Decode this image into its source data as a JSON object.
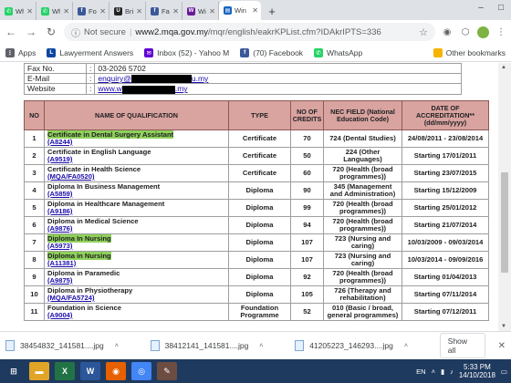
{
  "tabs": [
    {
      "title": "Wh",
      "icon": "whatsapp-icon",
      "color": "#25d366",
      "glyph": "✆"
    },
    {
      "title": "Wh",
      "icon": "whatsapp-icon",
      "color": "#25d366",
      "glyph": "✆"
    },
    {
      "title": "Fore",
      "icon": "facebook-icon",
      "color": "#3b5998",
      "glyph": "f"
    },
    {
      "title": "Britis",
      "icon": "ubuntu-u-icon",
      "color": "#222222",
      "glyph": "U"
    },
    {
      "title": "Face",
      "icon": "facebook-icon",
      "color": "#3b5998",
      "glyph": "f"
    },
    {
      "title": "Win",
      "icon": "win-icon",
      "color": "#6a1b9a",
      "glyph": "W"
    },
    {
      "title": "Win",
      "icon": "page-icon",
      "color": "#1565c0",
      "glyph": "▤",
      "active": true
    }
  ],
  "address": {
    "security": "Not secure",
    "host": "www2.mqa.gov.my",
    "path": "/mqr/english/eakrKPList.cfm?IDAkrIPTS=336"
  },
  "bookmarks": [
    {
      "label": "Apps",
      "icon": "apps-icon",
      "color": "#5f6368",
      "glyph": "⋮"
    },
    {
      "label": "Lawyerment Answers",
      "icon": "lawyerment-icon",
      "color": "#0d47a1",
      "glyph": "L"
    },
    {
      "label": "Inbox (52) - Yahoo M",
      "icon": "yahoo-mail-icon",
      "color": "#6001d2",
      "glyph": "✉"
    },
    {
      "label": "(70) Facebook",
      "icon": "facebook-icon",
      "color": "#3b5998",
      "glyph": "f"
    },
    {
      "label": "WhatsApp",
      "icon": "whatsapp-icon",
      "color": "#25d366",
      "glyph": "✆"
    }
  ],
  "other_bookmarks": "Other bookmarks",
  "contact": {
    "fax_label": "Fax No.",
    "fax": "03-2026 5702",
    "email_label": "E-Mail",
    "email_prefix": "enquiry@",
    "email_suffix": "u.my",
    "website_label": "Website",
    "website_prefix": "www.w",
    "website_suffix": ".my",
    "colon": ":"
  },
  "qualifications": {
    "headers": [
      "NO",
      "NAME OF QUALIFICATION",
      "TYPE",
      "NO OF CREDITS",
      "NEC FIELD (National Education Code)",
      "DATE OF ACCREDITATION** (dd/mm/yyyy)"
    ],
    "rows": [
      {
        "no": "1",
        "name": "Certificate in Dental Surgery Assistant",
        "code": "(A8244)",
        "type": "Certificate",
        "credits": "70",
        "nec": "724 (Dental Studies)",
        "date": "24/08/2011 - 23/08/2014",
        "highlight": true
      },
      {
        "no": "2",
        "name": "Certificate in English Language",
        "code": "(A9519)",
        "type": "Certificate",
        "credits": "50",
        "nec": "224 (Other Languages)",
        "date": "Starting 17/01/2011",
        "highlight": false
      },
      {
        "no": "3",
        "name": "Certificate in Health Science",
        "code": "(MQA/FA0520)",
        "type": "Certificate",
        "credits": "60",
        "nec": "720 (Health (broad programmes))",
        "date": "Starting 23/07/2015",
        "highlight": false
      },
      {
        "no": "4",
        "name": "Diploma In Business Management",
        "code": "(A5859)",
        "type": "Diploma",
        "credits": "90",
        "nec": "345 (Management and Administration)",
        "date": "Starting 15/12/2009",
        "highlight": false
      },
      {
        "no": "5",
        "name": "Diploma in Healthcare Management",
        "code": "(A9186)",
        "type": "Diploma",
        "credits": "99",
        "nec": "720 (Health (broad programmes))",
        "date": "Starting 25/01/2012",
        "highlight": false
      },
      {
        "no": "6",
        "name": "Diploma in Medical Science",
        "code": "(A9876)",
        "type": "Diploma",
        "credits": "94",
        "nec": "720 (Health (broad programmes))",
        "date": "Starting 21/07/2014",
        "highlight": false
      },
      {
        "no": "7",
        "name": "Diploma In Nursing",
        "code": "(A5973)",
        "type": "Diploma",
        "credits": "107",
        "nec": "723 (Nursing and caring)",
        "date": "10/03/2009 - 09/03/2014",
        "highlight": true
      },
      {
        "no": "8",
        "name": "Diploma in Nursing",
        "code": "(A11381)",
        "type": "Diploma",
        "credits": "107",
        "nec": "723 (Nursing and caring)",
        "date": "10/03/2014 - 09/09/2016",
        "highlight": true
      },
      {
        "no": "9",
        "name": "Diploma in Paramedic",
        "code": "(A9875)",
        "type": "Diploma",
        "credits": "92",
        "nec": "720 (Health (broad programmes))",
        "date": "Starting 01/04/2013",
        "highlight": false
      },
      {
        "no": "10",
        "name": "Diploma in Physiotherapy",
        "code": "(MQA/FA5724)",
        "type": "Diploma",
        "credits": "105",
        "nec": "726 (Therapy and rehabilitation)",
        "date": "Starting 07/11/2014",
        "highlight": false
      },
      {
        "no": "11",
        "name": "Foundation in Science",
        "code": "(A9004)",
        "type": "Foundation Programme",
        "credits": "52",
        "nec": "010 (Basic / broad, general programmes)",
        "date": "Starting 07/12/2011",
        "highlight": false
      }
    ]
  },
  "downloads": [
    {
      "name": "38454832_141581....jpg"
    },
    {
      "name": "38412141_141581....jpg"
    },
    {
      "name": "41205223_146293....jpg"
    }
  ],
  "show_all": "Show all",
  "taskbar": [
    {
      "icon": "start-icon",
      "color": "#1f3a5f",
      "glyph": "⊞"
    },
    {
      "icon": "file-explorer-icon",
      "color": "#e0a526",
      "glyph": "▬"
    },
    {
      "icon": "excel-icon",
      "color": "#217346",
      "glyph": "X"
    },
    {
      "icon": "word-icon",
      "color": "#2b579a",
      "glyph": "W"
    },
    {
      "icon": "firefox-icon",
      "color": "#e66000",
      "glyph": "◉"
    },
    {
      "icon": "chrome-icon",
      "color": "#4285f4",
      "glyph": "◎"
    },
    {
      "icon": "paint-icon",
      "color": "#6d4c41",
      "glyph": "✎"
    }
  ],
  "tray": {
    "lang": "EN",
    "time": "5:33 PM",
    "date": "14/10/2018"
  }
}
